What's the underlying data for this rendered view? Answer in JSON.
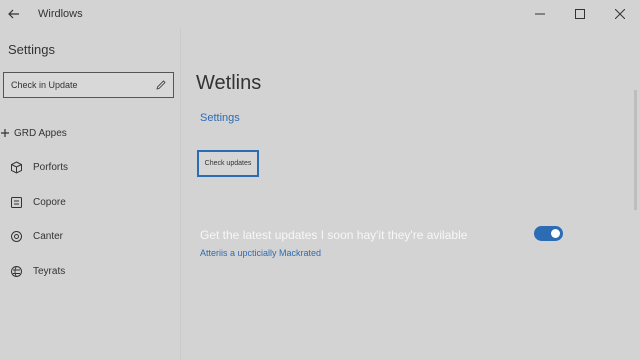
{
  "window": {
    "title": "Wirdlows",
    "controls": [
      "minimize",
      "maximize",
      "close"
    ]
  },
  "icons": {
    "back": "arrow-left-icon",
    "search": "pen-icon",
    "nav": [
      "plus-icon",
      "cube-icon",
      "box-icon",
      "target-icon",
      "globe-icon"
    ]
  },
  "sidebar": {
    "title": "Settings",
    "search": {
      "value": "Check in Update"
    },
    "items": [
      {
        "label": "GRD Appes"
      },
      {
        "label": "Porforts"
      },
      {
        "label": "Copore"
      },
      {
        "label": "Canter"
      },
      {
        "label": "Teyrats"
      }
    ]
  },
  "main": {
    "title": "Wetlins",
    "settings_link": "Settings",
    "check_button": "Check updates",
    "update_text": "Get the latest updates I soon hay'it they're avilable",
    "sub_link": "Atteriis a upcticially Mackrated",
    "toggle_on": true
  },
  "colors": {
    "background": "#d3d3d3",
    "accent": "#2b6cb5",
    "text": "#333333"
  }
}
